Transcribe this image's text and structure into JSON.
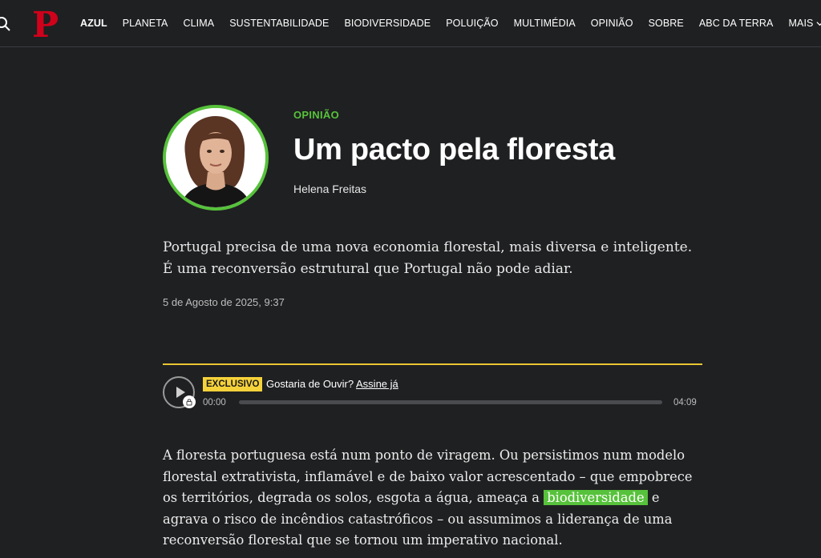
{
  "nav": {
    "logo_letter": "P",
    "items": [
      {
        "label": "AZUL",
        "active": true
      },
      {
        "label": "PLANETA"
      },
      {
        "label": "CLIMA"
      },
      {
        "label": "SUSTENTABILIDADE"
      },
      {
        "label": "BIODIVERSIDADE"
      },
      {
        "label": "POLUIÇÃO"
      },
      {
        "label": "MULTIMÉDIA"
      },
      {
        "label": "OPINIÃO"
      },
      {
        "label": "SOBRE"
      },
      {
        "label": "ABC DA TERRA"
      }
    ],
    "more_label": "MAIS"
  },
  "article": {
    "section": "OPINIÃO",
    "title": "Um pacto pela floresta",
    "author": "Helena Freitas",
    "lead": "Portugal precisa de uma nova economia florestal, mais diversa e inteligente. É uma reconversão estrutural que Portugal não pode adiar.",
    "date": "5 de Agosto de 2025, 9:37",
    "body": {
      "before": "A floresta portuguesa está num ponto de viragem. Ou persistimos num modelo florestal extrativista, inflamável e de baixo valor acrescentado – que empobrece os territórios, degrada os solos, esgota a água, ameaça a",
      "highlight": "biodiversidade",
      "after": "e agrava o risco de incêndios catastróficos – ou assumimos a liderança de uma reconversão florestal que se tornou um imperativo nacional."
    }
  },
  "audio": {
    "badge": "EXCLUSIVO",
    "prompt": "Gostaria de Ouvir?",
    "cta": "Assine já",
    "current_time": "00:00",
    "duration": "04:09",
    "progress": 0
  },
  "colors": {
    "accent": "#57c23b",
    "badge": "#f6d23a",
    "logo": "#d0021b",
    "background": "#1f2022"
  }
}
